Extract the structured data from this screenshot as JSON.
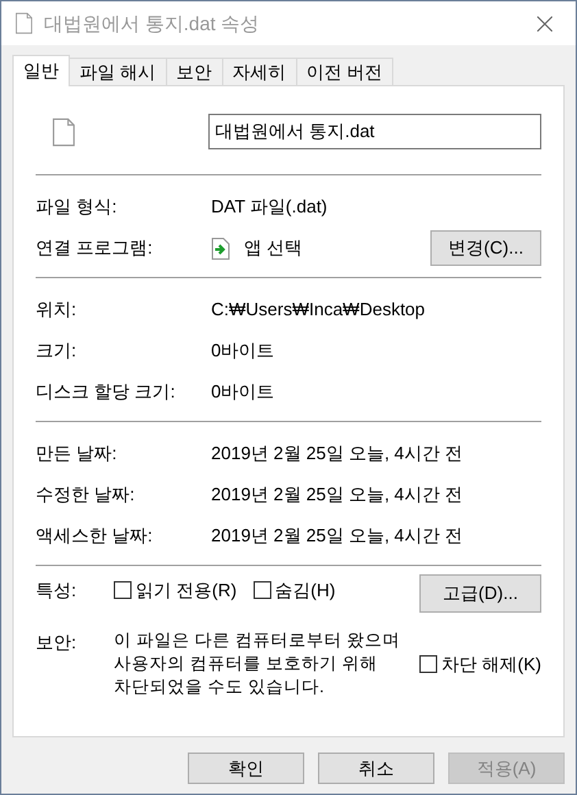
{
  "window": {
    "title": "대법원에서 통지.dat 속성"
  },
  "tabs": [
    {
      "label": "일반",
      "selected": true
    },
    {
      "label": "파일 해시",
      "selected": false
    },
    {
      "label": "보안",
      "selected": false
    },
    {
      "label": "자세히",
      "selected": false
    },
    {
      "label": "이전 버전",
      "selected": false
    }
  ],
  "file_name": "대법원에서 통지.dat",
  "sections": [
    [
      {
        "kind": "text",
        "label": "파일 형식:",
        "value": "DAT 파일(.dat)"
      },
      {
        "kind": "app",
        "label": "연결 프로그램:",
        "value": "앱 선택",
        "button": "변경(C)..."
      }
    ],
    [
      {
        "kind": "text",
        "label": "위치:",
        "value": "C:₩Users₩Inca₩Desktop"
      },
      {
        "kind": "text",
        "label": "크기:",
        "value": "0바이트"
      },
      {
        "kind": "text",
        "label": "디스크 할당 크기:",
        "value": "0바이트"
      }
    ],
    [
      {
        "kind": "text",
        "label": "만든 날짜:",
        "value": "2019년 2월 25일 오늘, 4시간 전"
      },
      {
        "kind": "text",
        "label": "수정한 날짜:",
        "value": "2019년 2월 25일 오늘, 4시간 전"
      },
      {
        "kind": "text",
        "label": "액세스한 날짜:",
        "value": "2019년 2월 25일 오늘, 4시간 전"
      }
    ]
  ],
  "attributes": {
    "label": "특성:",
    "options": [
      {
        "label": "읽기 전용(R)",
        "checked": false
      },
      {
        "label": "숨김(H)",
        "checked": false
      }
    ],
    "button": "고급(D)..."
  },
  "security": {
    "label": "보안:",
    "message": "이 파일은 다른 컴퓨터로부터 왔으며 사용자의 컴퓨터를 보호하기 위해 차단되었을 수도 있습니다.",
    "unblock": {
      "label": "차단 해제(K)",
      "checked": false
    }
  },
  "buttons": [
    {
      "label": "확인",
      "disabled": false
    },
    {
      "label": "취소",
      "disabled": false
    },
    {
      "label": "적용(A)",
      "disabled": true
    }
  ]
}
